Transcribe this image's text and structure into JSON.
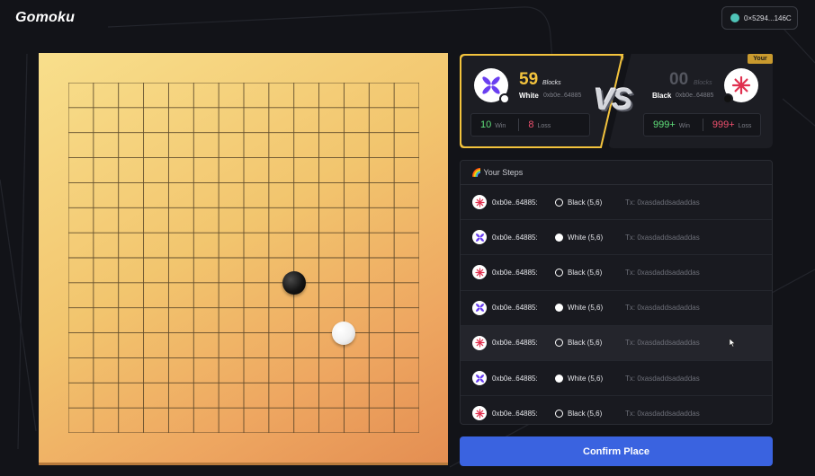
{
  "app": {
    "title": "Gomoku"
  },
  "wallet": {
    "address": "0×5294...146C",
    "dot_color": "#4fc4b8"
  },
  "board": {
    "size": 14,
    "stones": [
      {
        "color": "black",
        "col": 9,
        "row": 8
      },
      {
        "color": "white",
        "col": 11,
        "row": 10
      }
    ]
  },
  "players": {
    "white": {
      "blocks": "59",
      "blocks_label": "Blocks",
      "side": "White",
      "address": "0xb0e..64885",
      "wins": "10",
      "win_label": "Win",
      "losses": "8",
      "loss_label": "Loss"
    },
    "black": {
      "blocks": "00",
      "blocks_label": "Blocks",
      "side": "Black",
      "address": "0xb0e..64885",
      "wins": "999+",
      "win_label": "Win",
      "losses": "999+",
      "loss_label": "Loss",
      "tag": "Your"
    },
    "vs_label": "VS"
  },
  "steps": {
    "header": "🌈 Your Steps",
    "rows": [
      {
        "avatar": "black-flower-icon",
        "address": "0xb0e..64885:",
        "stone": "black",
        "move": "Black (5,6)",
        "tx": "Tx: 0xasdaddsadaddas"
      },
      {
        "avatar": "white-x-icon",
        "address": "0xb0e..64885:",
        "stone": "white",
        "move": "White (5,6)",
        "tx": "Tx: 0xasdaddsadaddas"
      },
      {
        "avatar": "black-flower-icon",
        "address": "0xb0e..64885:",
        "stone": "black",
        "move": "Black (5,6)",
        "tx": "Tx: 0xasdaddsadaddas"
      },
      {
        "avatar": "white-x-icon",
        "address": "0xb0e..64885:",
        "stone": "white",
        "move": "White (5,6)",
        "tx": "Tx: 0xasdaddsadaddas"
      },
      {
        "avatar": "black-flower-icon",
        "address": "0xb0e..64885:",
        "stone": "black",
        "move": "Black (5,6)",
        "tx": "Tx: 0xasdaddsadaddas",
        "highlighted": true
      },
      {
        "avatar": "white-x-icon",
        "address": "0xb0e..64885:",
        "stone": "white",
        "move": "White (5,6)",
        "tx": "Tx: 0xasdaddsadaddas"
      },
      {
        "avatar": "black-flower-icon",
        "address": "0xb0e..64885:",
        "stone": "black",
        "move": "Black (5,6)",
        "tx": "Tx: 0xasdaddsadaddas"
      }
    ]
  },
  "confirm": {
    "label": "Confirm Place"
  },
  "colors": {
    "accent_yellow": "#f3c33d",
    "win_green": "#5fe07a",
    "loss_red": "#f0506e",
    "button_blue": "#3a63e0"
  }
}
